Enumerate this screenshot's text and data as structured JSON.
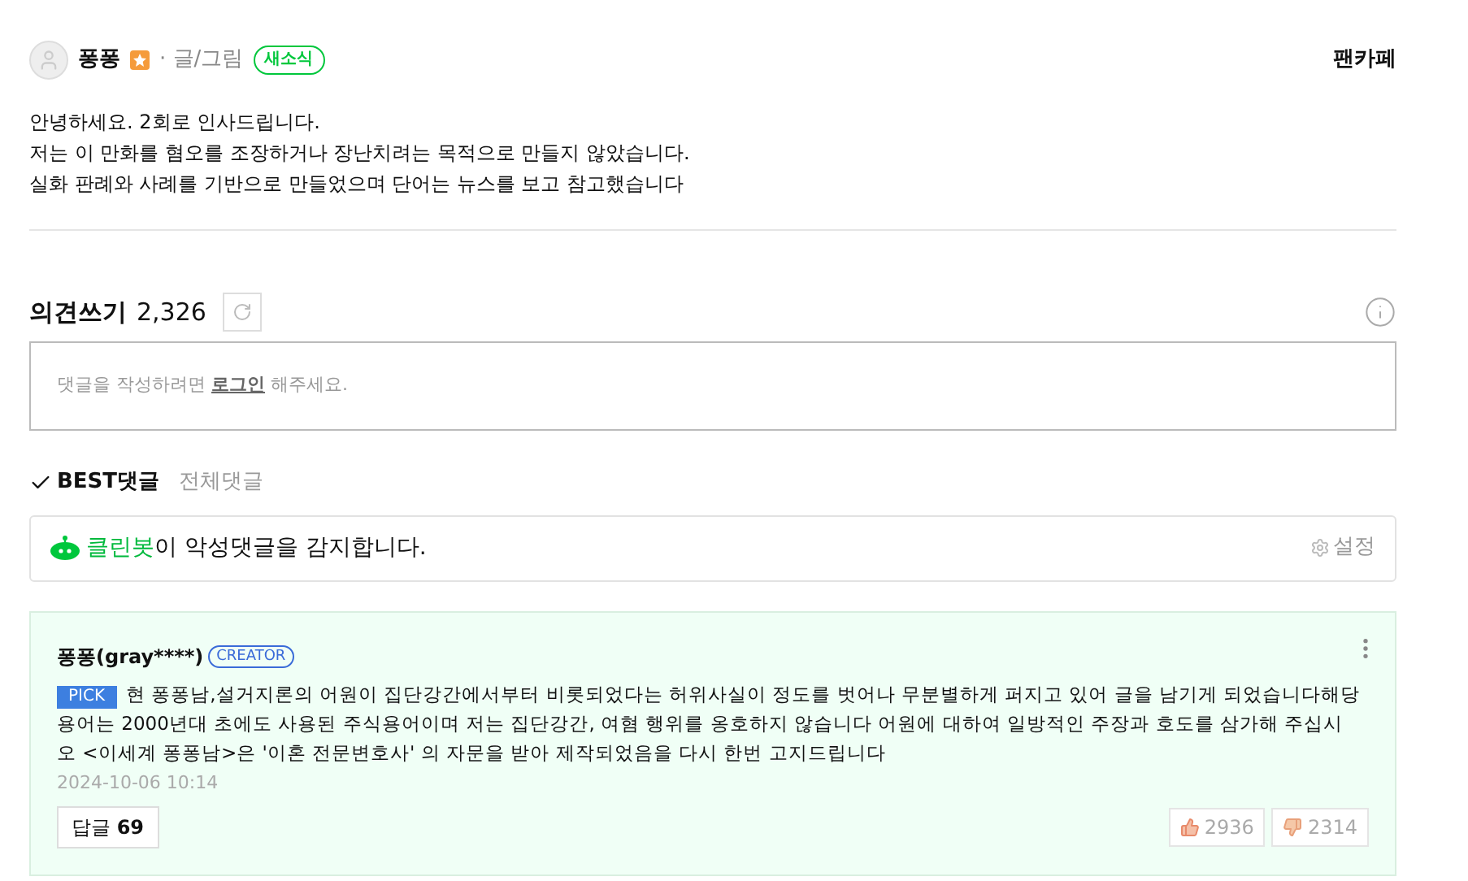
{
  "author": {
    "name": "퐁퐁",
    "role": "· 글/그림",
    "badge": "새소식"
  },
  "fancafe": "팬카페",
  "intro": [
    "안녕하세요. 2회로 인사드립니다.",
    "저는 이 만화를 혐오를 조장하거나 장난치려는 목적으로 만들지 않았습니다.",
    "실화 판례와 사례를 기반으로 만들었으며 단어는 뉴스를 보고 참고했습니다"
  ],
  "comments_header": {
    "title": "의견쓰기",
    "count": "2,326"
  },
  "comment_box": {
    "before": "댓글을 작성하려면",
    "link": "로그인",
    "after": "해주세요."
  },
  "tabs": [
    {
      "label": "BEST댓글",
      "selected": true
    },
    {
      "label": "전체댓글",
      "selected": false
    }
  ],
  "cleanbot": {
    "highlight": "클린봇",
    "text": "이 악성댓글을 감지합니다.",
    "settings": "설정"
  },
  "comments": [
    {
      "author": "퐁퐁(gray****)",
      "badge": "CREATOR",
      "pick": "PICK",
      "text": "현 퐁퐁남,설거지론의 어원이 집단강간에서부터 비롯되었다는 허위사실이 정도를 벗어나 무분별하게 퍼지고 있어 글을 남기게 되었습니다해당용어는 2000년대 초에도 사용된 주식용어이며 저는 집단강간, 여혐 행위를 옹호하지 않습니다 어원에 대하여 일방적인 주장과 호도를 삼가해 주십시오 <이세계 퐁퐁남>은 '이혼 전문변호사' 의 자문을 받아 제작되었음을 다시 한번 고지드립니다",
      "date": "2024-10-06 10:14",
      "reply_label": "답글",
      "reply_count": "69",
      "likes": "2936",
      "dislikes": "2314"
    }
  ]
}
